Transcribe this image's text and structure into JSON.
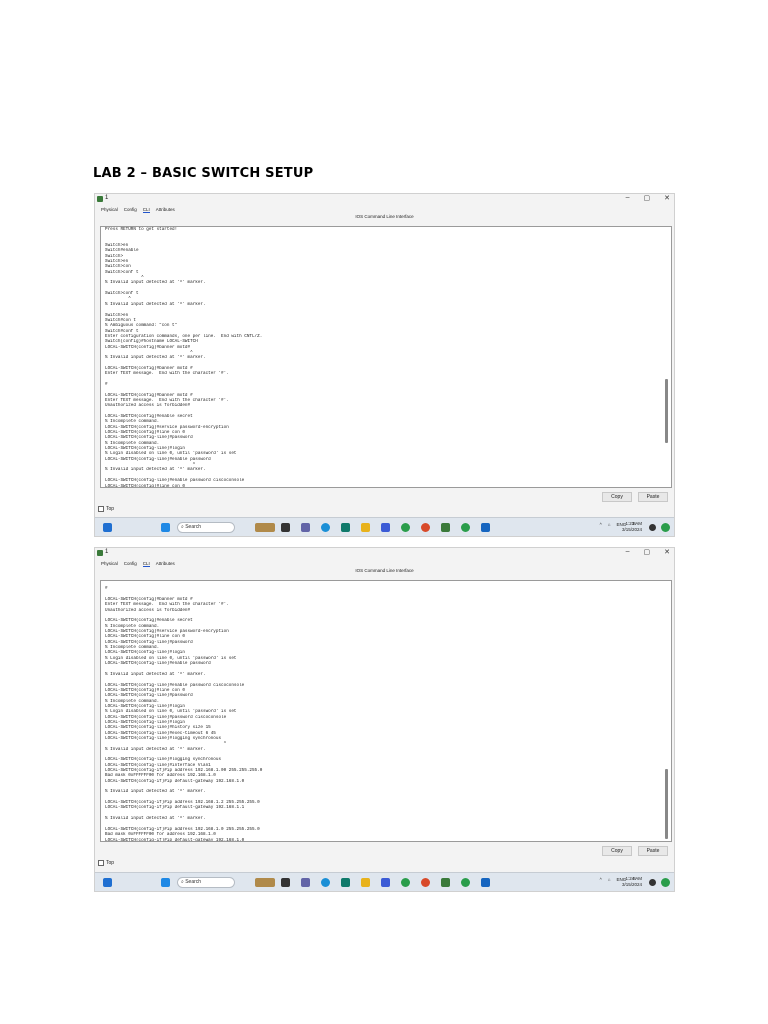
{
  "page": {
    "title": "LAB 2 – BASIC SWITCH SETUP"
  },
  "window": {
    "title": "1",
    "controls": [
      "–",
      "▢",
      "✕"
    ],
    "tabs": [
      "Physical",
      "Config",
      "CLI",
      "Attributes"
    ],
    "active_tab": "CLI",
    "cli_header": "IOS Command Line Interface",
    "copy_label": "Copy",
    "paste_label": "Paste",
    "top_label": "Top"
  },
  "taskbar": {
    "search_placeholder": "Search",
    "lang": "ENG",
    "date": "3/15/2024"
  },
  "screenshots": [
    {
      "time": "1:23 AM",
      "cli_lines": [
        "Press RETURN to get started!",
        "",
        "",
        "Switch>en",
        "Switch#enable",
        "Switch>",
        "Switch>en",
        "Switch>con",
        "Switch>conf t",
        "              ^",
        "% Invalid input detected at '^' marker.",
        "",
        "Switch>conf t",
        "         ^",
        "% Invalid input detected at '^' marker.",
        "",
        "Switch>en",
        "Switch#con t",
        "% Ambiguous command: \"con t\"",
        "Switch#conf t",
        "Enter configuration commands, one per line.  End with CNTL/Z.",
        "Switch(config)#hostname LOCAL-SWITCH",
        "LOCAL-SWITCH(config)#banner motd#",
        "                                 ^",
        "% Invalid input detected at '^' marker.",
        "",
        "LOCAL-SWITCH(config)#banner motd #",
        "Enter TEXT message.  End with the character '#'.",
        "",
        "#",
        "",
        "LOCAL-SWITCH(config)#banner motd #",
        "Enter TEXT message.  End with the character '#'.",
        "Unauthorized access is forbidden#",
        "",
        "LOCAL-SWITCH(config)#enable secret",
        "% Incomplete command.",
        "LOCAL-SWITCH(config)#service password-encryption",
        "LOCAL-SWITCH(config)#line con 0",
        "LOCAL-SWITCH(config-line)#password",
        "% Incomplete command.",
        "LOCAL-SWITCH(config-line)#login",
        "% Login disabled on line 0, until 'password' is set",
        "LOCAL-SWITCH(config-line)#enable password",
        "                                  ^",
        "% Invalid input detected at '^' marker.",
        "",
        "LOCAL-SWITCH(config-line)#enable password ciscoconsole",
        "LOCAL-SWITCH(config)#line con 0",
        "LOCAL-SWITCH(config-line)#password"
      ]
    },
    {
      "time": "1:24 AM",
      "cli_lines": [
        "",
        "#",
        "",
        "LOCAL-SWITCH(config)#banner motd #",
        "Enter TEXT message.  End with the character '#'.",
        "Unauthorized access is forbidden#",
        "",
        "LOCAL-SWITCH(config)#enable secret",
        "% Incomplete command.",
        "LOCAL-SWITCH(config)#service password-encryption",
        "LOCAL-SWITCH(config)#line con 0",
        "LOCAL-SWITCH(config-line)#password",
        "% Incomplete command.",
        "LOCAL-SWITCH(config-line)#login",
        "% Login disabled on line 0, until 'password' is set",
        "LOCAL-SWITCH(config-line)#enable password",
        "",
        "% Invalid input detected at '^' marker.",
        "",
        "LOCAL-SWITCH(config-line)#enable password ciscoconsole",
        "LOCAL-SWITCH(config)#line con 0",
        "LOCAL-SWITCH(config-line)#password",
        "% Incomplete command.",
        "LOCAL-SWITCH(config-line)#login",
        "% Login disabled on line 0, until 'password' is set",
        "LOCAL-SWITCH(config-line)#password ciscoconsole",
        "LOCAL-SWITCH(config-line)#login",
        "LOCAL-SWITCH(config-line)#history size 15",
        "LOCAL-SWITCH(config-line)#exec-timeout 6 45",
        "LOCAL-SWITCH(config-line)#logging synchronous",
        "                                              ^",
        "% Invalid input detected at '^' marker.",
        "",
        "LOCAL-SWITCH(config-line)#logging synchronous",
        "LOCAL-SWITCH(config-line)#interface Vlan1",
        "LOCAL-SWITCH(config-if)#ip address 192.168.1.00 255.255.255.0",
        "Bad mask 0xFFFFFF00 for address 192.168.1.0",
        "LOCAL-SWITCH(config-if)#ip default-gateway 192.168.1.0",
        "",
        "% Invalid input detected at '^' marker.",
        "",
        "LOCAL-SWITCH(config-if)#ip address 192.168.1.2 255.255.255.0",
        "LOCAL-SWITCH(config-if)#ip default-gateway 192.168.1.1",
        "",
        "% Invalid input detected at '^' marker.",
        "",
        "LOCAL-SWITCH(config-if)#ip address 192.168.1.0 255.255.255.0",
        "Bad mask 0xFFFFFF00 for address 192.168.1.0",
        "LOCAL-SWITCH(config-if)#ip default-gateway 192.168.1.0",
        "LOCAL-SWITCH(config)#"
      ]
    }
  ],
  "colors": {
    "taskbar_bg": "#dfe6ee",
    "accent_blue": "#2255cc"
  }
}
